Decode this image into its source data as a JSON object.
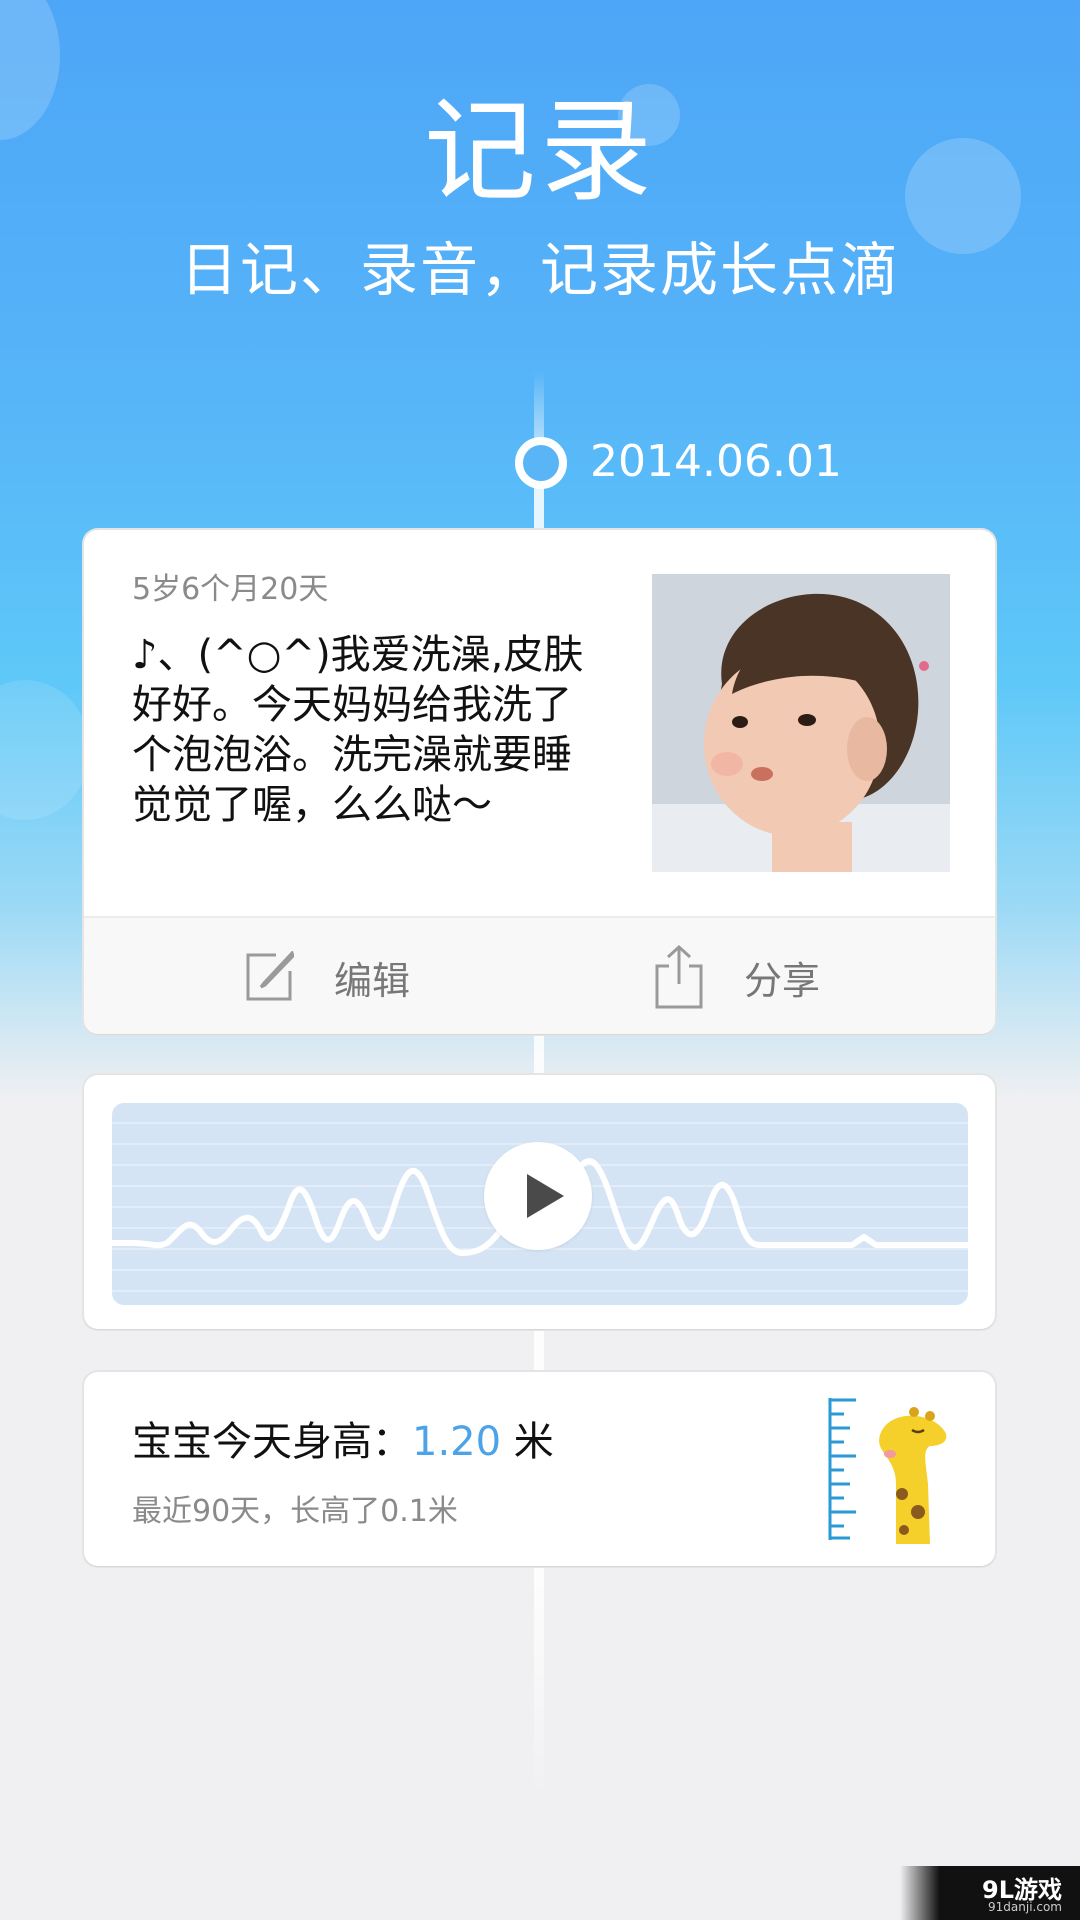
{
  "header": {
    "title": "记录",
    "subtitle": "日记、录音，记录成长点滴"
  },
  "timeline": {
    "date": "2014.06.01"
  },
  "diary_card": {
    "age": "5岁6个月20天",
    "text": "♪、(^○^)我爱洗澡,皮肤好好。今天妈妈给我洗了个泡泡浴。洗完澡就要睡觉觉了喔，么么哒～",
    "edit_label": "编辑",
    "share_label": "分享"
  },
  "height_card": {
    "prefix": "宝宝今天身高：",
    "value": "1.20",
    "unit": "米",
    "note": "最近90天，长高了0.1米"
  },
  "watermark": {
    "brand": "9L游戏",
    "url": "91danji.com"
  },
  "colors": {
    "accent_blue": "#4da3e8",
    "sky_top": "#4da6f7",
    "giraffe_yellow": "#f5cf2a",
    "ruler_blue": "#2a9ad6"
  }
}
